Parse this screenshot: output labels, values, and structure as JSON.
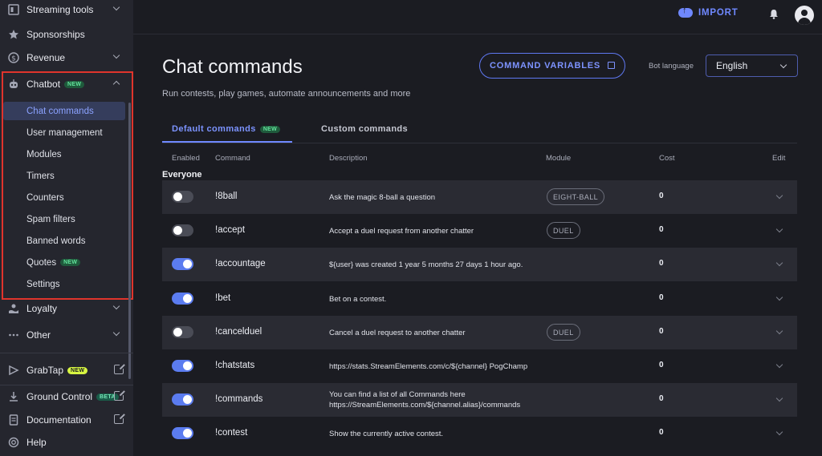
{
  "sidebar": {
    "top_items": [
      {
        "label": "Streaming tools"
      },
      {
        "label": "Sponsorships"
      },
      {
        "label": "Revenue"
      },
      {
        "label": "Chatbot",
        "badge": "NEW"
      }
    ],
    "chatbot_sub": [
      {
        "label": "Chat commands"
      },
      {
        "label": "User management"
      },
      {
        "label": "Modules"
      },
      {
        "label": "Timers"
      },
      {
        "label": "Counters"
      },
      {
        "label": "Spam filters"
      },
      {
        "label": "Banned words"
      },
      {
        "label": "Quotes",
        "badge": "NEW"
      },
      {
        "label": "Settings"
      }
    ],
    "lower_items": [
      {
        "label": "Loyalty"
      },
      {
        "label": "Other"
      }
    ],
    "bottom_items": [
      {
        "label": "GrabTap",
        "badge": "NEW"
      },
      {
        "label": "Ground Control",
        "badge": "BETA"
      },
      {
        "label": "Documentation"
      },
      {
        "label": "Help"
      }
    ]
  },
  "topbar": {
    "import_label": "IMPORT"
  },
  "header": {
    "title": "Chat commands",
    "subtitle": "Run contests, play games, automate announcements and more",
    "variables_button": "COMMAND VARIABLES",
    "bot_language_label": "Bot language",
    "bot_language_value": "English"
  },
  "tabs": [
    {
      "label": "Default commands",
      "badge": "NEW"
    },
    {
      "label": "Custom commands"
    }
  ],
  "table": {
    "headers": [
      "Enabled",
      "Command",
      "Description",
      "Module",
      "Cost",
      "Edit"
    ],
    "group": "Everyone",
    "rows": [
      {
        "enabled": false,
        "command": "!8ball",
        "description": "Ask the magic 8-ball a question",
        "module": "EIGHT-BALL",
        "cost": "0"
      },
      {
        "enabled": false,
        "command": "!accept",
        "description": "Accept a duel request from another chatter",
        "module": "DUEL",
        "cost": "0"
      },
      {
        "enabled": true,
        "command": "!accountage",
        "description": "${user} was created 1 year 5 months 27 days 1 hour ago.",
        "module": "",
        "cost": "0"
      },
      {
        "enabled": true,
        "command": "!bet",
        "description": "Bet on a contest.",
        "module": "",
        "cost": "0"
      },
      {
        "enabled": false,
        "command": "!cancelduel",
        "description": "Cancel a duel request to another chatter",
        "module": "DUEL",
        "cost": "0"
      },
      {
        "enabled": true,
        "command": "!chatstats",
        "description": "https://stats.StreamElements.com/c/${channel} PogChamp",
        "module": "",
        "cost": "0"
      },
      {
        "enabled": true,
        "command": "!commands",
        "description": "You can find a list of all Commands here https://StreamElements.com/${channel.alias}/commands",
        "module": "",
        "cost": "0"
      },
      {
        "enabled": true,
        "command": "!contest",
        "description": "Show the currently active contest.",
        "module": "",
        "cost": "0"
      }
    ]
  },
  "colors": {
    "accent": "#6f88ff",
    "highlight_border": "#e0342c",
    "toggle_on": "#5b7cf0"
  }
}
